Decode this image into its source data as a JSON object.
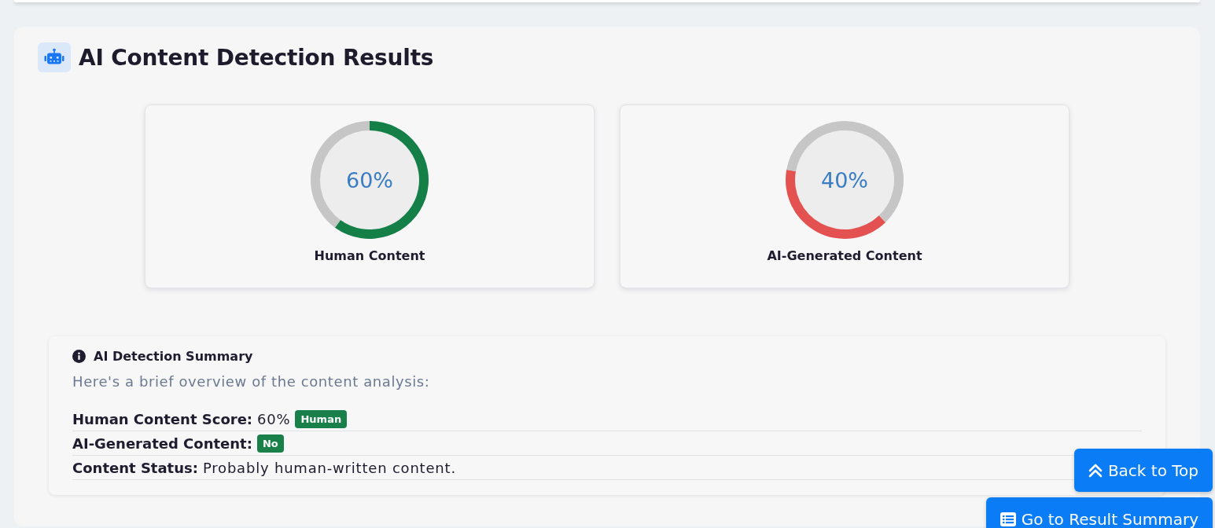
{
  "title": "AI Content Detection Results",
  "gauges": [
    {
      "kind": "human",
      "reading": "60%",
      "label": "Human Content",
      "color": "#157f48",
      "chart_data": {
        "type": "donut",
        "values": [
          60,
          40
        ]
      }
    },
    {
      "kind": "ai",
      "reading": "40%",
      "label": "AI-Generated Content",
      "color": "#e35150",
      "chart_data": {
        "type": "donut",
        "values": [
          40,
          60
        ]
      }
    }
  ],
  "summary": {
    "heading": "AI Detection Summary",
    "intro": "Here's a brief overview of the content analysis:",
    "rows": [
      {
        "label": "Human Content Score:",
        "value": "60%",
        "badge": "Human"
      },
      {
        "label": "AI-Generated Content:",
        "badge": "No"
      },
      {
        "label": "Content Status:",
        "value": "Probably human-written content."
      }
    ]
  },
  "buttons": [
    {
      "kind": "top",
      "label": "Back to Top"
    },
    {
      "kind": "summary",
      "label": "Go to Result Summary"
    }
  ]
}
